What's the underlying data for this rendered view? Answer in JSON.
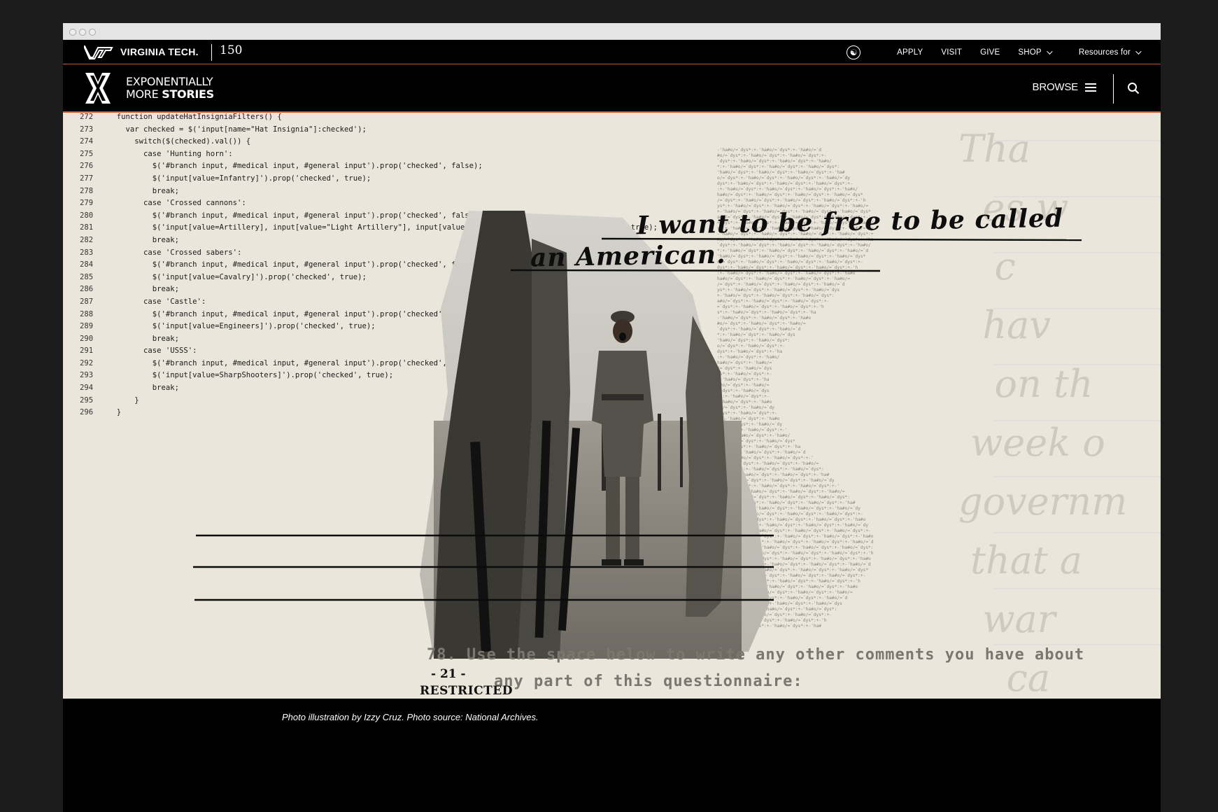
{
  "utility_nav": {
    "brand_name": "VIRGINIA TECH.",
    "anniversary": "150",
    "links": [
      "APPLY",
      "VISIT",
      "GIVE",
      "SHOP",
      "Resources for"
    ]
  },
  "header": {
    "brand_line1": "EXPONENTIALLY",
    "brand_line2_a": "MORE ",
    "brand_line2_b": "STORIES",
    "browse_label": "BROWSE"
  },
  "hero": {
    "code_lines": [
      {
        "n": "272",
        "t": "  function updateHatInsigniaFilters() {"
      },
      {
        "n": "273",
        "t": "    var checked = $('input[name=\"Hat Insignia\"]:checked');"
      },
      {
        "n": "274",
        "t": "      switch($(checked).val()) {"
      },
      {
        "n": "275",
        "t": "        case 'Hunting horn':"
      },
      {
        "n": "276",
        "t": "          $('#branch input, #medical input, #general input').prop('checked', false);"
      },
      {
        "n": "277",
        "t": "          $('input[value=Infantry]').prop('checked', true);"
      },
      {
        "n": "278",
        "t": "          break;"
      },
      {
        "n": "279",
        "t": "        case 'Crossed cannons':"
      },
      {
        "n": "280",
        "t": "          $('#branch input, #medical input, #general input').prop('checked', false);"
      },
      {
        "n": "281",
        "t": "          $('input[value=Artillery], input[value=\"Light Artillery\"], input[value=\"Me"
      },
      {
        "n": "282",
        "t": "          break;"
      },
      {
        "n": "283",
        "t": "        case 'Crossed sabers':"
      },
      {
        "n": "284",
        "t": "          $('#branch input, #medical input, #general input').prop('checked', false);"
      },
      {
        "n": "285",
        "t": "          $('input[value=Cavalry]').prop('checked', true);"
      },
      {
        "n": "286",
        "t": "          break;"
      },
      {
        "n": "287",
        "t": "        case 'Castle':"
      },
      {
        "n": "288",
        "t": "          $('#branch input, #medical input, #general input').prop('checked', fal"
      },
      {
        "n": "289",
        "t": "          $('input[value=Engineers]').prop('checked', true);"
      },
      {
        "n": "290",
        "t": "          break;"
      },
      {
        "n": "291",
        "t": "        case 'USSS':"
      },
      {
        "n": "292",
        "t": "          $('#branch input, #medical input, #general input').prop('checked',"
      },
      {
        "n": "293",
        "t": "          $('input[value=SharpShooters]').prop('checked', true);"
      },
      {
        "n": "294",
        "t": "          break;"
      },
      {
        "n": "295",
        "t": "      }"
      },
      {
        "n": "296",
        "t": "  }"
      }
    ],
    "code_fragment": "prop('checked', true);",
    "handwritten_line1": "I want to be free to be called",
    "handwritten_line2": "an American.",
    "typed_line1": "78.  Use the space below to write any other comments you have about",
    "typed_line2": "any part of this questionnaire:",
    "page_number": "- 21 -",
    "restricted_label": "RESTRICTED"
  },
  "caption": "Photo illustration by Izzy Cruz. Photo source: National Archives.",
  "colors": {
    "accent": "#c45a24",
    "paper": "#ebe6db",
    "header_bg": "#000000"
  },
  "icons": [
    "accessibility-icon",
    "chevron-down-icon",
    "menu-icon",
    "search-icon",
    "vt-logo",
    "x-logo"
  ]
}
